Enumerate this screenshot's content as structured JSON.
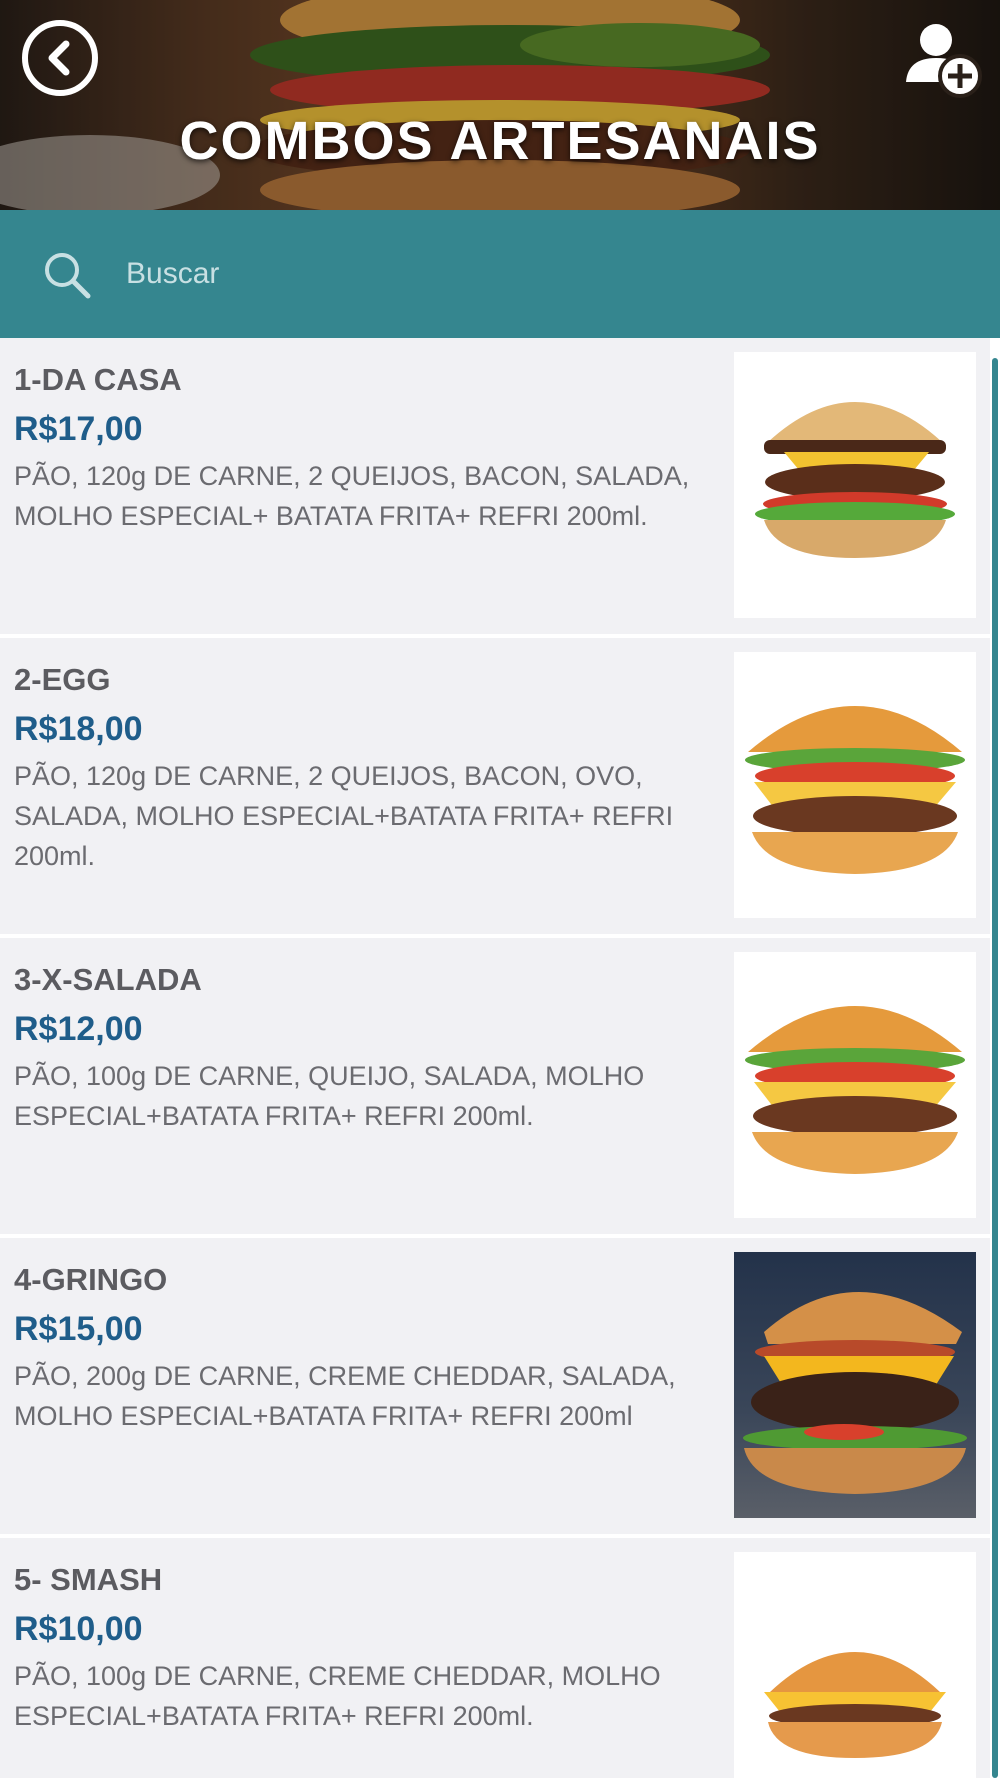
{
  "header": {
    "title": "COMBOS ARTESANAIS",
    "back_icon": "chevron-left-circle-icon",
    "add_user_icon": "add-user-icon"
  },
  "search": {
    "placeholder": "Buscar",
    "icon": "search-icon"
  },
  "colors": {
    "accent": "#35868f",
    "price": "#1f5d8a",
    "item_bg": "#f1f1f4"
  },
  "items": [
    {
      "name": "1-DA CASA",
      "price": "R$17,00",
      "description": "PÃO, 120g DE CARNE, 2 QUEIJOS, BACON, SALADA, MOLHO ESPECIAL+ BATATA FRITA+ REFRI 200ml."
    },
    {
      "name": "2-EGG",
      "price": "R$18,00",
      "description": "PÃO, 120g DE CARNE, 2 QUEIJOS, BACON, OVO, SALADA, MOLHO ESPECIAL+BATATA FRITA+ REFRI 200ml."
    },
    {
      "name": "3-X-SALADA",
      "price": "R$12,00",
      "description": "PÃO, 100g DE CARNE, QUEIJO, SALADA, MOLHO ESPECIAL+BATATA FRITA+ REFRI 200ml."
    },
    {
      "name": "4-GRINGO",
      "price": "R$15,00",
      "description": "PÃO, 200g DE CARNE, CREME CHEDDAR, SALADA, MOLHO ESPECIAL+BATATA FRITA+ REFRI 200ml"
    },
    {
      "name": "5- SMASH",
      "price": "R$10,00",
      "description": "PÃO, 100g DE CARNE, CREME CHEDDAR, MOLHO ESPECIAL+BATATA FRITA+ REFRI 200ml."
    }
  ]
}
